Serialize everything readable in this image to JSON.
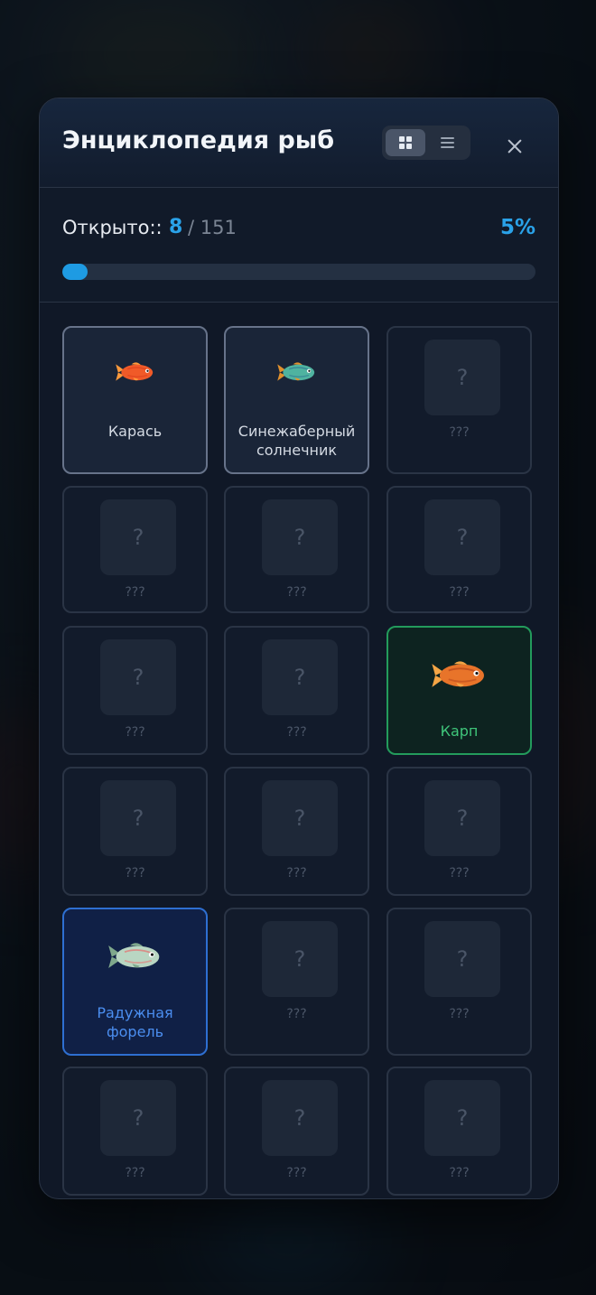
{
  "modal": {
    "title": "Энциклопедия рыб",
    "close_label": "×"
  },
  "progress": {
    "label": "Открыто::",
    "discovered": "8",
    "total": "/ 151",
    "percent_text": "5%",
    "fraction": 0.053
  },
  "cards": [
    {
      "name": "Карась",
      "state": "discovered",
      "icon": "crucian-carp-icon",
      "colors": {
        "body": "#f05a28",
        "fin": "#ff9a3c",
        "accent": "#d93a1a"
      }
    },
    {
      "name": "Синежаберный солнечник",
      "state": "discovered",
      "icon": "bluegill-icon",
      "colors": {
        "body": "#4fb3a0",
        "fin": "#e0902d",
        "accent": "#2b6e8f"
      }
    },
    {
      "unknown": "???",
      "qmark": "?"
    },
    {
      "unknown": "???",
      "qmark": "?"
    },
    {
      "unknown": "???",
      "qmark": "?"
    },
    {
      "unknown": "???",
      "qmark": "?"
    },
    {
      "unknown": "???",
      "qmark": "?"
    },
    {
      "unknown": "???",
      "qmark": "?"
    },
    {
      "name": "Карп",
      "state": "rare",
      "icon": "carp-icon",
      "colors": {
        "body": "#e8742a",
        "fin": "#f4a545",
        "accent": "#b5451b"
      }
    },
    {
      "unknown": "???",
      "qmark": "?"
    },
    {
      "unknown": "???",
      "qmark": "?"
    },
    {
      "unknown": "???",
      "qmark": "?"
    },
    {
      "name": "Радужная форель",
      "state": "uncommon",
      "icon": "rainbow-trout-icon",
      "colors": {
        "body": "#b9d6c2",
        "fin": "#7fa88c",
        "accent": "#e76f6f"
      }
    },
    {
      "unknown": "???",
      "qmark": "?"
    },
    {
      "unknown": "???",
      "qmark": "?"
    },
    {
      "unknown": "???",
      "qmark": "?"
    },
    {
      "unknown": "???",
      "qmark": "?"
    },
    {
      "unknown": "???",
      "qmark": "?"
    }
  ]
}
